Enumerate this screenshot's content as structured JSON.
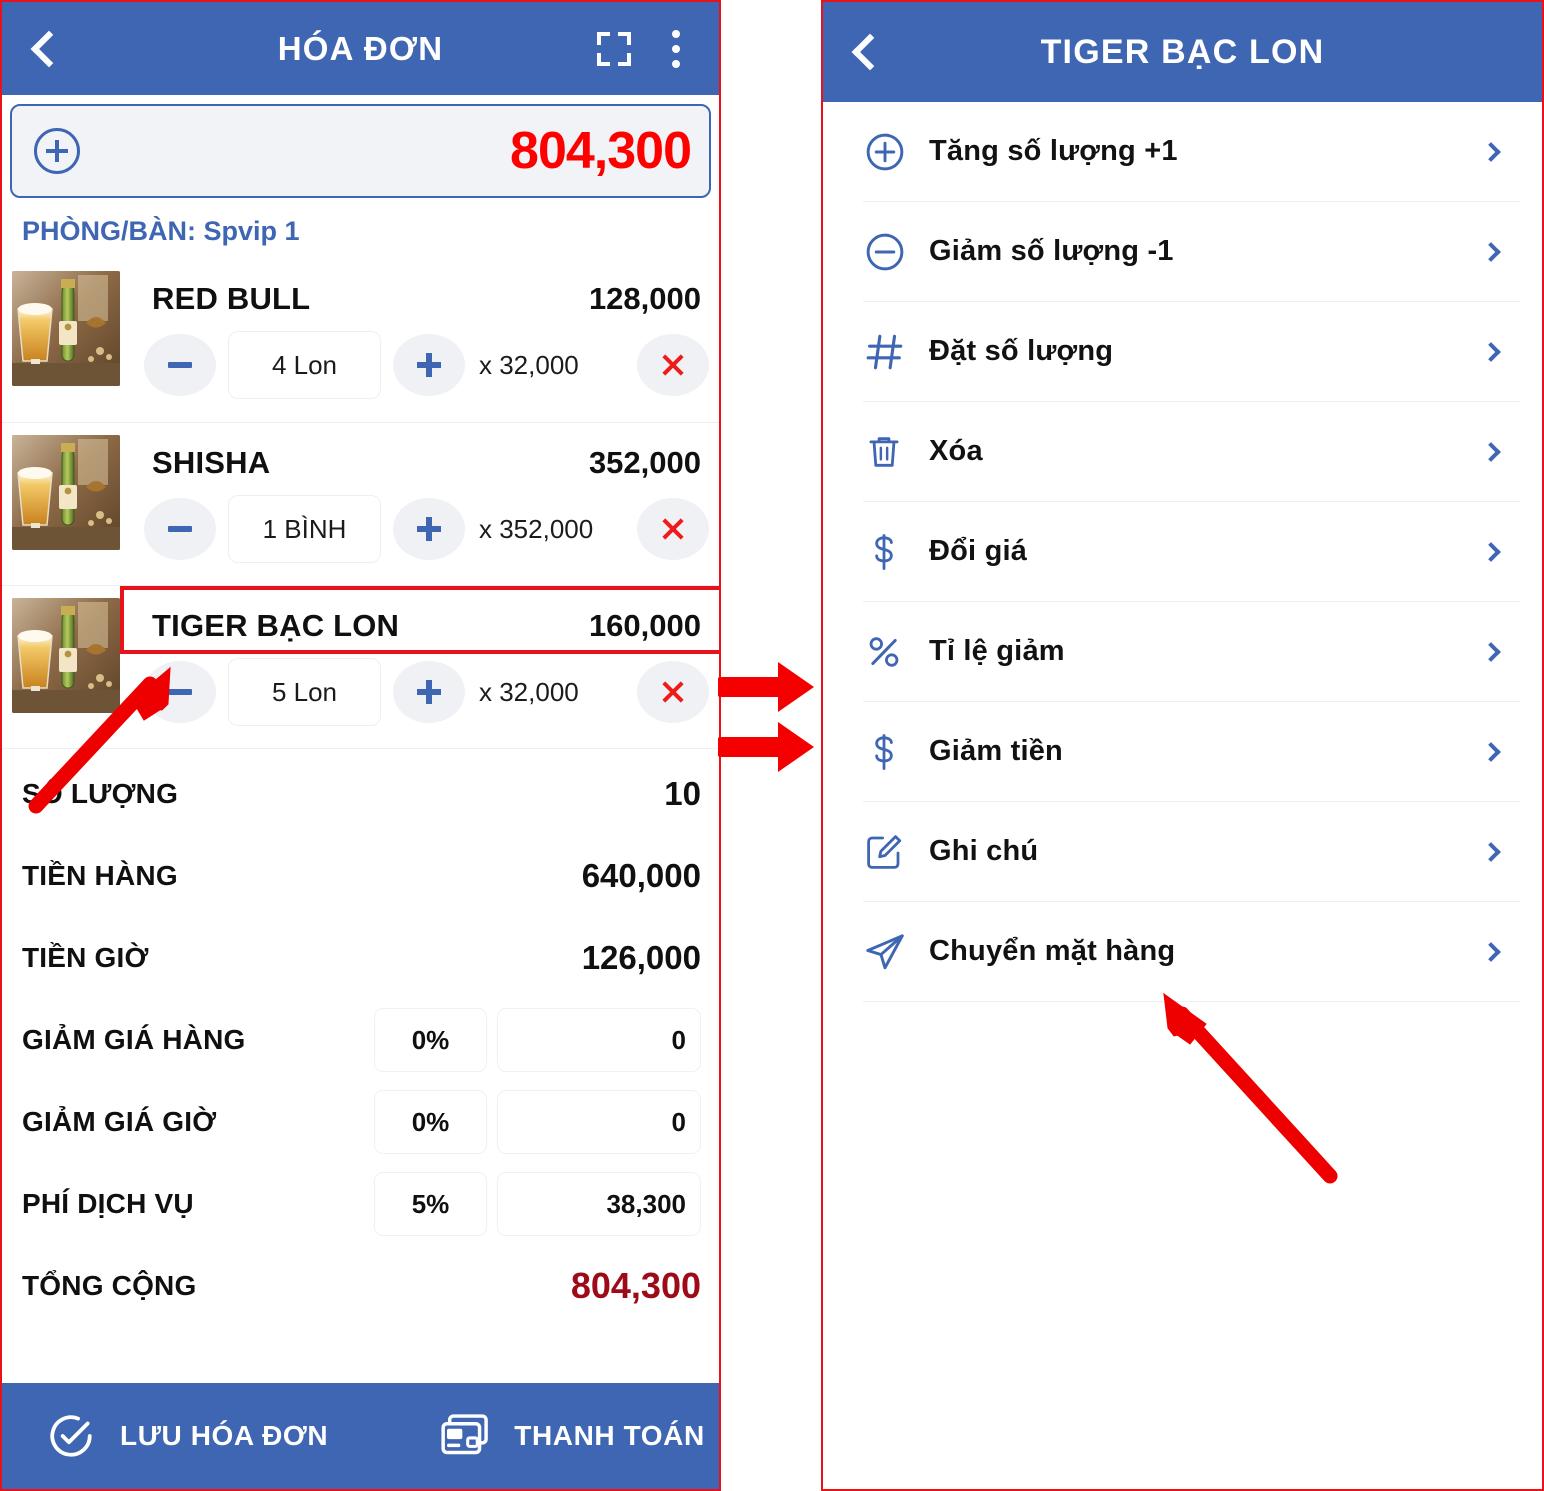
{
  "colors": {
    "brand_blue": "#3F66B2",
    "accent_red": "#FF0000",
    "total_dark_red": "#9E0B18",
    "annotation_red": "#E8121A"
  },
  "left_panel": {
    "appbar": {
      "title": "HÓA ĐƠN",
      "back_icon": "chevron-left-icon",
      "scan_icon": "fullscreen-scan-icon",
      "more_icon": "overflow-menu-icon"
    },
    "total_card": {
      "add_icon": "plus-circle-icon",
      "amount": "804,300"
    },
    "room_label": "PHÒNG/BÀN: Spvip 1",
    "products": [
      {
        "name": "RED BULL",
        "line_total": "128,000",
        "quantity": "4 Lon",
        "unit_price": "x 32,000",
        "minus_icon": "minus-icon",
        "plus_icon": "plus-icon",
        "remove_icon": "close-x-icon",
        "highlighted": false
      },
      {
        "name": "SHISHA",
        "line_total": "352,000",
        "quantity": "1 BÌNH",
        "unit_price": "x 352,000",
        "minus_icon": "minus-icon",
        "plus_icon": "plus-icon",
        "remove_icon": "close-x-icon",
        "highlighted": false
      },
      {
        "name": "TIGER BẠC LON",
        "line_total": "160,000",
        "quantity": "5 Lon",
        "unit_price": "x 32,000",
        "minus_icon": "minus-icon",
        "plus_icon": "plus-icon",
        "remove_icon": "close-x-icon",
        "highlighted": true
      }
    ],
    "summary": [
      {
        "label": "SỐ LƯỢNG",
        "value": "10",
        "type": "value"
      },
      {
        "label": "TIỀN HÀNG",
        "value": "640,000",
        "type": "value"
      },
      {
        "label": "TIỀN GIỜ",
        "value": "126,000",
        "type": "value"
      },
      {
        "label": "GIẢM GIÁ HÀNG",
        "percent": "0%",
        "amount": "0",
        "type": "fields"
      },
      {
        "label": "GIẢM GIÁ GIỜ",
        "percent": "0%",
        "amount": "0",
        "type": "fields"
      },
      {
        "label": "PHÍ DỊCH VỤ",
        "percent": "5%",
        "amount": "38,300",
        "type": "fields"
      },
      {
        "label": "TỔNG CỘNG",
        "value": "804,300",
        "type": "total"
      }
    ],
    "bottombar": {
      "save_icon": "check-circle-icon",
      "save_label": "LƯU HÓA ĐƠN",
      "pay_icon": "card-payment-icon",
      "pay_label": "THANH TOÁN"
    }
  },
  "right_panel": {
    "appbar": {
      "title": "TIGER BẠC LON",
      "back_icon": "chevron-left-icon"
    },
    "menu": [
      {
        "label": "Tăng số lượng +1",
        "icon": "plus-circle-icon"
      },
      {
        "label": "Giảm số lượng -1",
        "icon": "minus-circle-icon"
      },
      {
        "label": "Đặt số lượng",
        "icon": "hash-icon"
      },
      {
        "label": "Xóa",
        "icon": "trash-icon"
      },
      {
        "label": "Đổi giá",
        "icon": "dollar-icon"
      },
      {
        "label": "Tỉ lệ giảm",
        "icon": "percent-icon"
      },
      {
        "label": "Giảm tiền",
        "icon": "dollar-icon"
      },
      {
        "label": "Ghi chú",
        "icon": "edit-note-icon"
      },
      {
        "label": "Chuyển mặt hàng",
        "icon": "send-paper-plane-icon"
      }
    ]
  },
  "annotations": {
    "flow_arrows_icon": "double-right-arrow-icon",
    "callout_left_icon": "pointer-arrow-icon",
    "callout_right_icon": "pointer-arrow-icon"
  }
}
